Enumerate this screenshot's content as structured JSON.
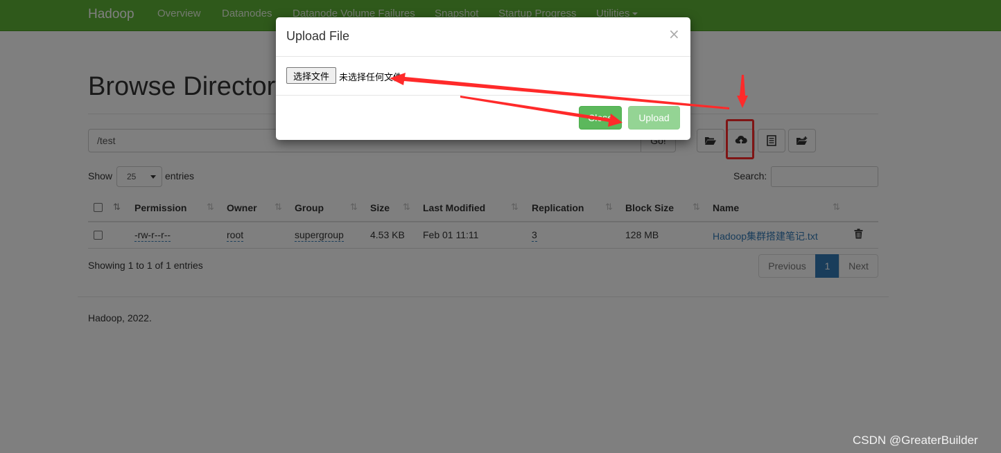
{
  "navbar": {
    "brand": "Hadoop",
    "items": [
      "Overview",
      "Datanodes",
      "Datanode Volume Failures",
      "Snapshot",
      "Startup Progress",
      "Utilities"
    ]
  },
  "page": {
    "title": "Browse Directory",
    "path_value": "/test",
    "go_label": "Go!"
  },
  "toolbar": {
    "icons": [
      "folder-open-icon",
      "cloud-upload-icon",
      "list-icon",
      "folder-plus-icon"
    ]
  },
  "table_controls": {
    "show_label": "Show",
    "entries_value": "25",
    "entries_label": "entries",
    "search_label": "Search:"
  },
  "table": {
    "columns": [
      "Permission",
      "Owner",
      "Group",
      "Size",
      "Last Modified",
      "Replication",
      "Block Size",
      "Name"
    ],
    "rows": [
      {
        "permission": "-rw-r--r--",
        "owner": "root",
        "group": "supergroup",
        "size": "4.53 KB",
        "last_modified": "Feb 01 11:11",
        "replication": "3",
        "block_size": "128 MB",
        "name": "Hadoop集群搭建笔记.txt"
      }
    ]
  },
  "pagination": {
    "info": "Showing 1 to 1 of 1 entries",
    "previous": "Previous",
    "current": "1",
    "next": "Next"
  },
  "footer": {
    "text": "Hadoop, 2022."
  },
  "modal": {
    "title": "Upload File",
    "close_symbol": "×",
    "choose_file_label": "选择文件",
    "no_file_text": "未选择任何文件",
    "close_label": "Close",
    "upload_label": "Upload"
  },
  "watermark": "CSDN @GreaterBuilder",
  "colors": {
    "navbar": "#5fb336",
    "link": "#337ab7",
    "success": "#5cb85c",
    "annotation": "#ff2a2a"
  }
}
